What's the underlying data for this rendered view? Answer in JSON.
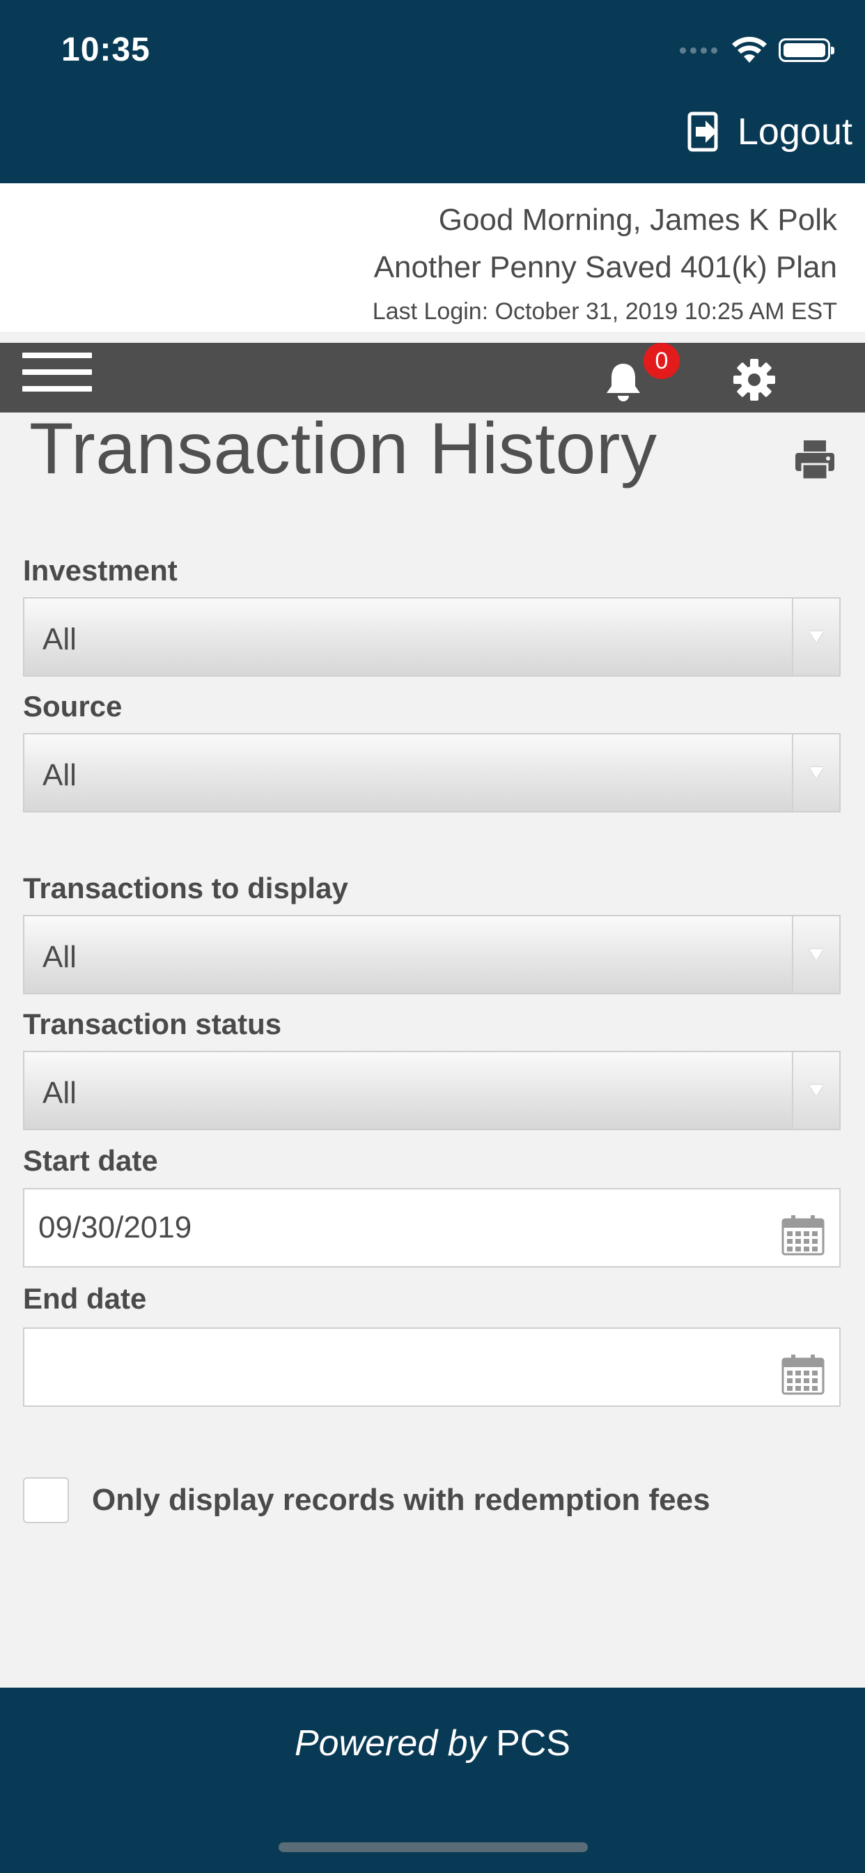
{
  "status_bar": {
    "time": "10:35"
  },
  "header": {
    "logout_label": "Logout"
  },
  "greeting": {
    "greeting_text": "Good Morning,  James K Polk",
    "plan_name": "Another Penny Saved 401(k) Plan",
    "last_login": "Last Login: October 31, 2019 10:25 AM EST"
  },
  "nav": {
    "notification_count": "0"
  },
  "page": {
    "title": "Transaction History"
  },
  "filters": {
    "investment": {
      "label": "Investment",
      "value": "All"
    },
    "source": {
      "label": "Source",
      "value": "All"
    },
    "transactions_to_display": {
      "label": "Transactions to display",
      "value": "All"
    },
    "transaction_status": {
      "label": "Transaction status",
      "value": "All"
    },
    "start_date": {
      "label": "Start date",
      "value": "09/30/2019"
    },
    "end_date": {
      "label": "End date",
      "value": ""
    },
    "redemption_fees_checkbox": {
      "label": "Only display records with redemption fees",
      "checked": false
    }
  },
  "footer": {
    "powered_prefix": "Powered by",
    "brand": "PCS"
  },
  "colors": {
    "brand_navy": "#093a55",
    "nav_gray": "#4e4e4e",
    "badge_red": "#e41b1b",
    "page_bg": "#f2f2f2"
  }
}
